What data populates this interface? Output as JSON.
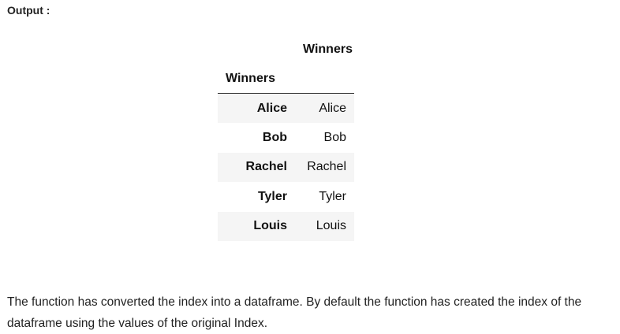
{
  "output_label": "Output :",
  "dataframe": {
    "column_header": "Winners",
    "index_name": "Winners",
    "rows": [
      {
        "index": "Alice",
        "value": "Alice"
      },
      {
        "index": "Bob",
        "value": "Bob"
      },
      {
        "index": "Rachel",
        "value": "Rachel"
      },
      {
        "index": "Tyler",
        "value": "Tyler"
      },
      {
        "index": "Louis",
        "value": "Louis"
      }
    ]
  },
  "description": "The function has converted the index into a dataframe. By default the function has created the index of the dataframe using the values of the original Index."
}
